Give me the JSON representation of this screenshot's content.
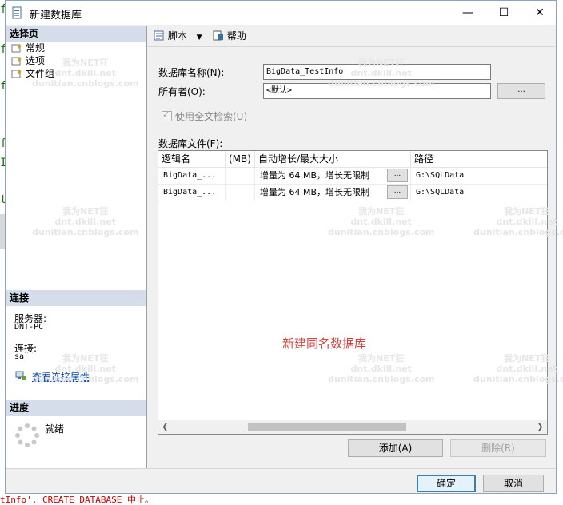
{
  "window": {
    "title": "新建数据库",
    "controls": {
      "minimize": "—",
      "maximize": "☐",
      "close": "✕"
    }
  },
  "left_pane": {
    "select_page_header": "选择页",
    "pages": [
      {
        "label": "常规",
        "icon": "page-settings-icon"
      },
      {
        "label": "选项",
        "icon": "page-settings-icon"
      },
      {
        "label": "文件组",
        "icon": "page-settings-icon"
      }
    ],
    "connection_header": "连接",
    "server_label": "服务器:",
    "server_value": "DNT-PC",
    "connection_label": "连接:",
    "connection_value": "sa",
    "view_properties_link": "查看连接属性",
    "progress_header": "进度",
    "progress_status": "就绪"
  },
  "toolbar": {
    "script_label": "脚本",
    "help_label": "帮助"
  },
  "form": {
    "db_name_label": "数据库名称(N):",
    "db_name_value": "BigData_TestInfo",
    "owner_label": "所有者(O):",
    "owner_value": "<默认>",
    "browse_button": "...",
    "fulltext_label": "使用全文检索(U)",
    "files_label": "数据库文件(F):"
  },
  "grid": {
    "columns": [
      "逻辑名",
      "(MB)",
      "自动增长/最大大小",
      "路径"
    ],
    "rows": [
      {
        "logical_name": "BigData_...",
        "size": "",
        "autogrowth": "增量为 64 MB，增长无限制",
        "cell_button": "...",
        "path": "G:\\SQLData"
      },
      {
        "logical_name": "BigData_...",
        "size": "",
        "autogrowth": "增量为 64 MB，增长无限制",
        "cell_button": "...",
        "path": "G:\\SQLData"
      }
    ],
    "annotation": "新建同名数据库"
  },
  "buttons": {
    "add": "添加(A)",
    "remove": "删除(R)",
    "ok": "确定",
    "cancel": "取消"
  },
  "background": {
    "bottom_text": "tInfo'. CREATE DATABASE 中止。"
  },
  "watermark": {
    "line1": "我为NET狂",
    "line2": "dnt.dkill.net",
    "line3": "dunitian.cnblogs.com"
  },
  "colors": {
    "section_header": "#d4dde9",
    "link": "#0645ad",
    "annotation": "#d0433a",
    "primary_border": "#3c7fb1"
  }
}
